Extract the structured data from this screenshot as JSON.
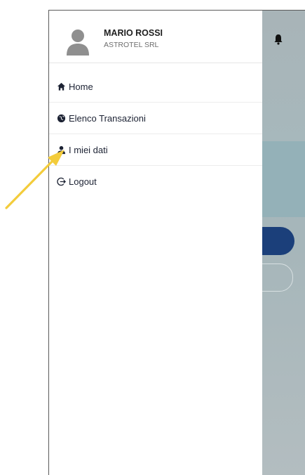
{
  "user": {
    "name": "MARIO ROSSI",
    "company": "ASTROTEL SRL"
  },
  "menu": {
    "items": [
      {
        "label": "Home",
        "icon": "home-icon"
      },
      {
        "label": "Elenco Transazioni",
        "icon": "globe-icon"
      },
      {
        "label": "I miei dati",
        "icon": "person-icon"
      },
      {
        "label": "Logout",
        "icon": "logout-icon"
      }
    ]
  },
  "colors": {
    "primary": "#1b3f7a",
    "annotation_arrow": "#f3cc3b",
    "drawer_text": "#1c2233"
  }
}
